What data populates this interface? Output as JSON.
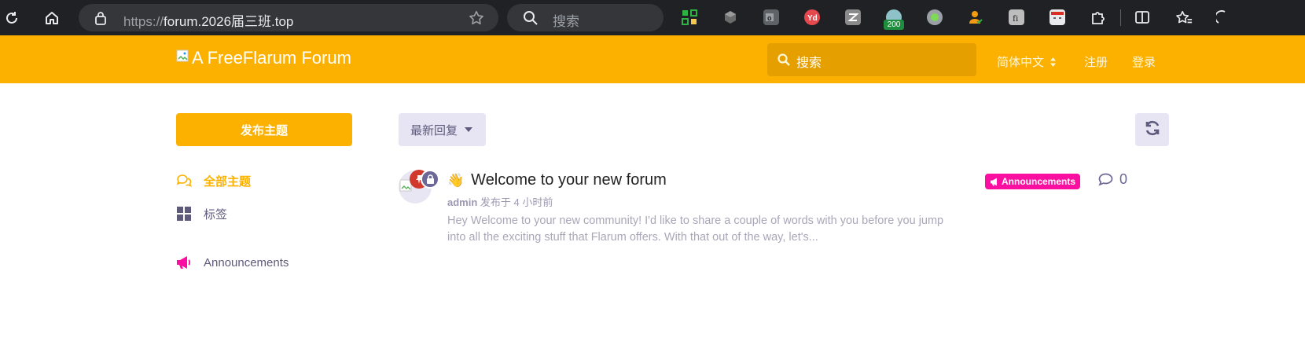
{
  "browser": {
    "url_proto": "https://",
    "url_rest": "forum.2026届三班.top",
    "search_placeholder": "搜索",
    "extension_badge": "200"
  },
  "header": {
    "brand": "A FreeFlarum Forum",
    "search_placeholder": "搜索",
    "language": "简体中文",
    "signup": "注册",
    "login": "登录"
  },
  "sidebar": {
    "start_discussion": "发布主题",
    "items": [
      {
        "label": "全部主题",
        "icon": "comments-icon",
        "color": "#fcb100"
      },
      {
        "label": "标签",
        "icon": "tags-grid-icon",
        "color": "#5e5a7b"
      },
      {
        "label": "Announcements",
        "icon": "bullhorn-icon",
        "color": "#5e5a7b"
      }
    ]
  },
  "toolbar": {
    "sort_label": "最新回复"
  },
  "discussion": {
    "emoji": "👋",
    "title": "Welcome to your new forum",
    "author": "admin",
    "meta": "发布于 4 小时前",
    "excerpt": "Hey Welcome to your new community! I'd like to share a couple of words with you before you jump into all the exciting stuff that Flarum offers. With that out of the way, let's...",
    "tag": "Announcements",
    "tag_color": "#fa0fa0",
    "replies": "0"
  },
  "colors": {
    "primary": "#fcb100",
    "secondary": "#e7e5f4",
    "text_muted": "#5e5a7b"
  }
}
